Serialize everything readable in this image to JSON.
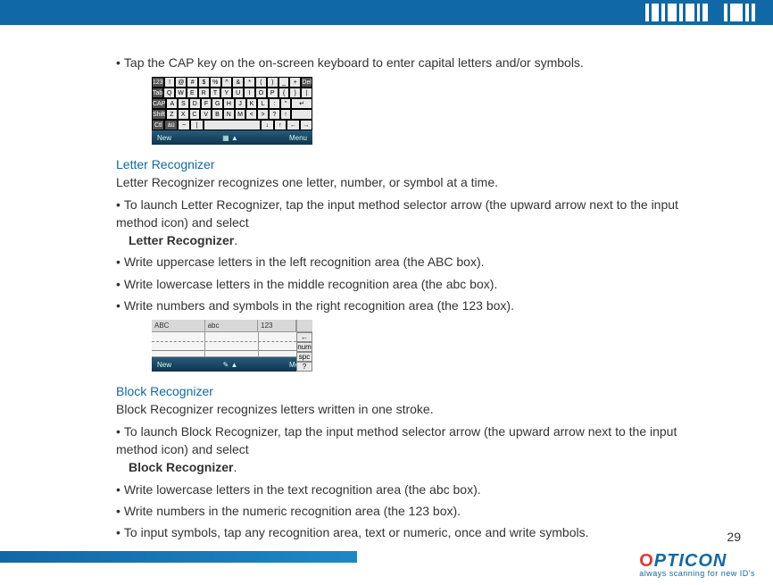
{
  "cap_bullet": "Tap the CAP key on the on-screen keyboard to enter capital letters and/or symbols.",
  "figure1_bottom_left": "New",
  "figure1_bottom_right": "Menu",
  "letter_recognizer": {
    "title": "Letter Recognizer",
    "intro": "Letter Recognizer recognizes one letter, number, or symbol at a time.",
    "b1a": "To launch Letter Recognizer, tap the input method selector arrow (the upward arrow next to the input method icon) and select ",
    "b1b": "Letter Recognizer",
    "b1c": ".",
    "b2": "Write uppercase letters in the left recognition area (the ABC box).",
    "b3": "Write lowercase letters in the middle recognition area (the abc box).",
    "b4": "Write numbers and symbols in the right recognition area (the 123 box)."
  },
  "figure2": {
    "zone1": "ABC",
    "zone2": "abc",
    "zone3": "123",
    "side": [
      "←",
      "num",
      "spc",
      "?"
    ],
    "bottom_left": "New",
    "bottom_right": "Menu"
  },
  "block_recognizer": {
    "title": "Block Recognizer",
    "intro": "Block Recognizer recognizes letters written in one stroke.",
    "b1a": "To launch Block Recognizer, tap the input method selector arrow (the upward arrow next to the input method icon) and select ",
    "b1b": "Block Recognizer",
    "b1c": ".",
    "b2": "Write lowercase letters in the text recognition area (the abc box).",
    "b3": "Write numbers in the numeric recognition area (the 123 box).",
    "b4": "To input symbols, tap any recognition area, text or numeric, once and write symbols."
  },
  "page_number": "29",
  "brand_tag": "always scanning for new ID's"
}
